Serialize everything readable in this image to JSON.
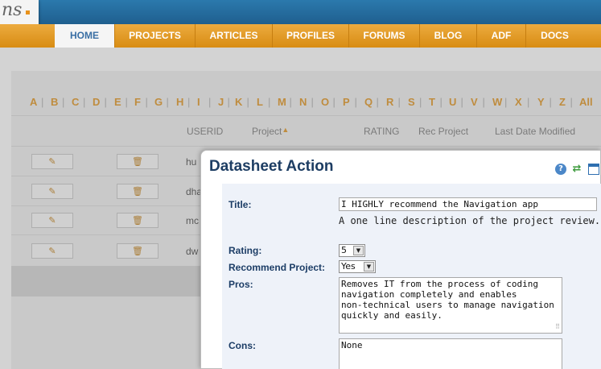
{
  "logo": {
    "text": "ns",
    "dot": "."
  },
  "nav": [
    "HOME",
    "PROJECTS",
    "ARTICLES",
    "PROFILES",
    "FORUMS",
    "BLOG",
    "ADF",
    "DOCS"
  ],
  "alphabet": [
    "A",
    "B",
    "C",
    "D",
    "E",
    "F",
    "G",
    "H",
    "I",
    "J",
    "K",
    "L",
    "M",
    "N",
    "O",
    "P",
    "Q",
    "R",
    "S",
    "T",
    "U",
    "V",
    "W",
    "X",
    "Y",
    "Z",
    "All"
  ],
  "separator": "|",
  "table": {
    "columns": [
      "USERID",
      "Project",
      "RATING",
      "Rec Project",
      "Last Date Modified"
    ],
    "sort_arrow": "▲",
    "rows": [
      "hu",
      "dha",
      "mc",
      "dw"
    ],
    "edit_icon": "✎",
    "delete_icon": "🗑"
  },
  "dialog": {
    "title": "Datasheet Action",
    "help_icon": "?",
    "refresh_icon": "⇄",
    "title_label": "Title:",
    "title_value": "I HIGHLY recommend the Navigation app",
    "title_desc": "A one line description of the project review.",
    "rating_label": "Rating:",
    "rating_value": "5",
    "recommend_label": "Recommend Project:",
    "recommend_value": "Yes",
    "pros_label": "Pros:",
    "pros_lines": [
      "Removes IT from the process of coding",
      "navigation completely and enables",
      "non-technical users to manage navigation",
      "quickly and easily."
    ],
    "cons_label": "Cons:",
    "cons_value": "None",
    "dropdown_arrow": "▼",
    "resize_grip": "⠿"
  },
  "colors": {
    "accent": "#e0921b",
    "header_blue": "#2b79ad",
    "label_blue": "#1c3d66"
  }
}
